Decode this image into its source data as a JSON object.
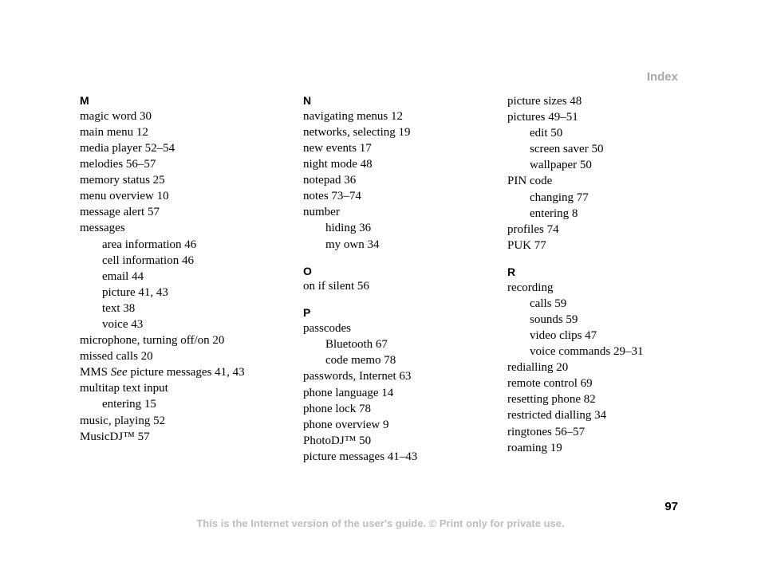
{
  "header": "Index",
  "page_number": "97",
  "footer": "This is the Internet version of the user's guide. © Print only for private use.",
  "col1": {
    "letter_m": "M",
    "m": [
      "magic word 30",
      "main menu 12",
      "media player 52–54",
      "melodies 56–57",
      "memory status 25",
      "menu overview 10",
      "message alert 57",
      "messages"
    ],
    "m_sub": [
      "area information 46",
      "cell information 46",
      "email 44",
      "picture 41, 43",
      "text 38",
      "voice 43"
    ],
    "m2a": "microphone, turning off/on 20",
    "m2b": "missed calls 20",
    "m2c_pre": "MMS ",
    "m2c_italic": "See",
    "m2c_post": " picture messages 41, 43",
    "m2d": "multitap text input",
    "m2d_sub": "entering 15",
    "m2e": "music, playing 52",
    "m2f": "MusicDJ™ 57"
  },
  "col2": {
    "letter_n": "N",
    "n": [
      "navigating menus 12",
      "networks, selecting 19",
      "new events 17",
      "night mode 48",
      "notepad 36",
      "notes 73–74",
      "number"
    ],
    "n_sub": [
      "hiding 36",
      "my own 34"
    ],
    "letter_o": "O",
    "o1": "on if silent 56",
    "letter_p": "P",
    "p1": "passcodes",
    "p1_sub": [
      "Bluetooth 67",
      "code memo 78"
    ],
    "p_rest": [
      "passwords, Internet 63",
      "phone language 14",
      "phone lock 78",
      "phone overview 9",
      "PhotoDJ™ 50",
      "picture messages 41–43"
    ]
  },
  "col3": {
    "top": [
      "picture sizes 48",
      "pictures 49–51"
    ],
    "top_sub": [
      "edit 50",
      "screen saver 50",
      "wallpaper 50"
    ],
    "pin": "PIN code",
    "pin_sub": [
      "changing 77",
      "entering 8"
    ],
    "after_pin": [
      "profiles 74",
      "PUK 77"
    ],
    "letter_r": "R",
    "r1": "recording",
    "r1_sub": [
      "calls 59",
      "sounds 59",
      "video clips 47",
      "voice commands 29–31"
    ],
    "r_rest": [
      "redialling 20",
      "remote control 69",
      "resetting phone 82",
      "restricted dialling 34",
      "ringtones 56–57",
      "roaming 19"
    ]
  }
}
